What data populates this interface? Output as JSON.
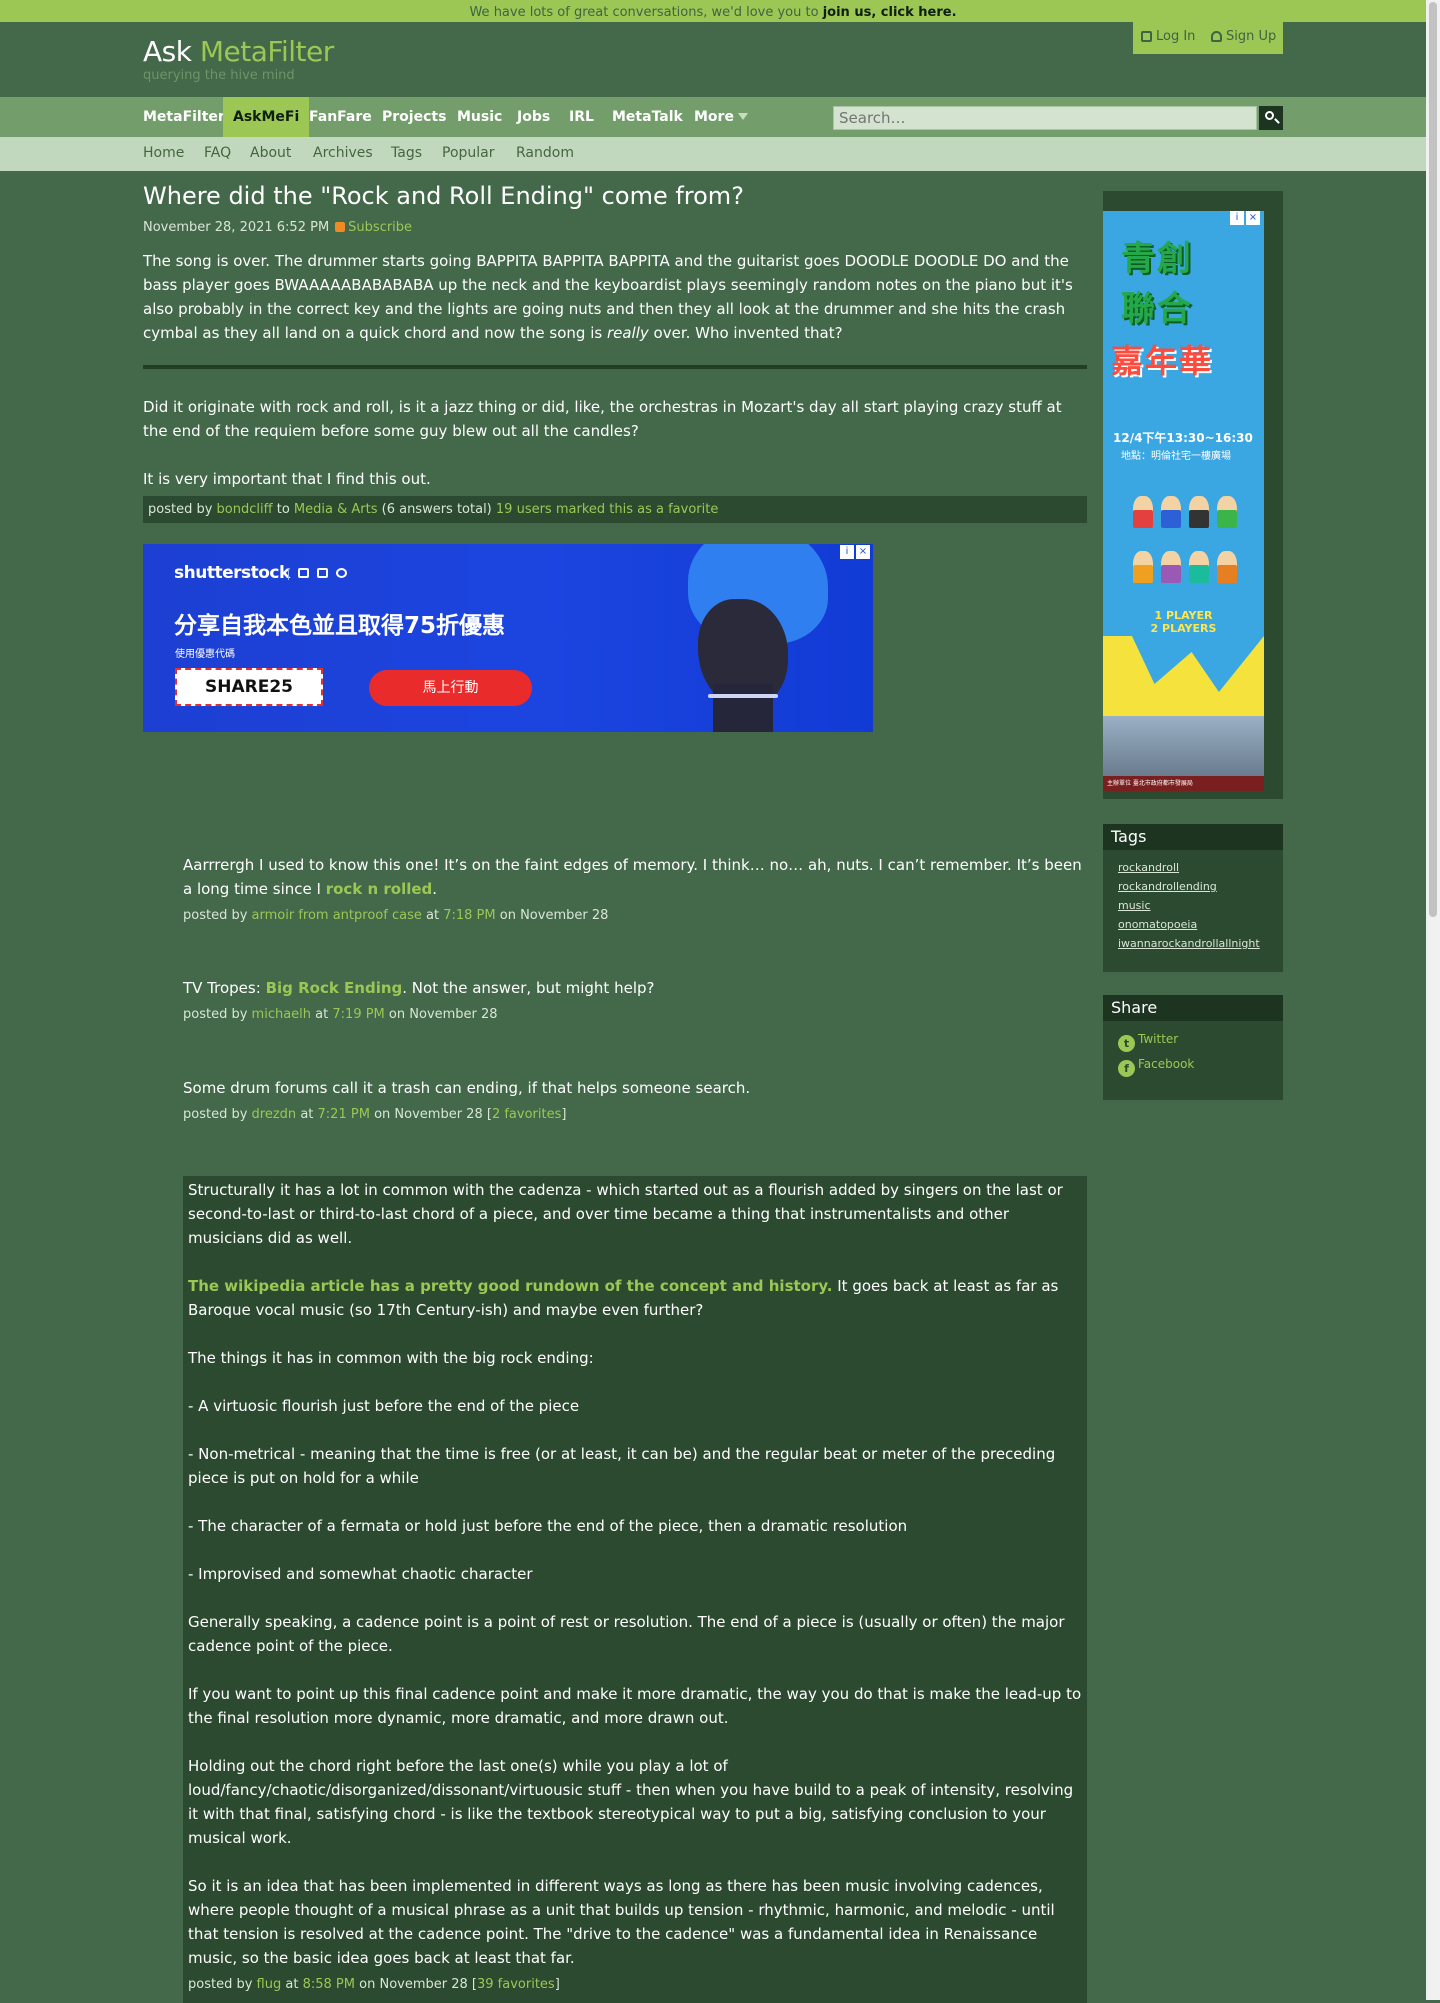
{
  "announcement": {
    "text": "We have lots of great conversations, we'd love you to ",
    "link": "join us, click here."
  },
  "header": {
    "brand_ask": "Ask",
    "brand_mefi": "MetaFilter",
    "tagline": "querying the hive mind",
    "login": "Log In",
    "signup": "Sign Up"
  },
  "nav": {
    "items": [
      "MetaFilter",
      "AskMeFi",
      "FanFare",
      "Projects",
      "Music",
      "Jobs",
      "IRL",
      "MetaTalk",
      "More"
    ],
    "active": "AskMeFi",
    "search_placeholder": "Search…"
  },
  "subnav": [
    "Home",
    "FAQ",
    "About",
    "Archives",
    "Tags",
    "Popular",
    "Random"
  ],
  "post": {
    "title": "Where did the \"Rock and Roll Ending\" come from?",
    "date": "November 28, 2021 6:52 PM",
    "subscribe": "Subscribe",
    "body_pre": "The song is over. The drummer starts going BAPPITA BAPPITA BAPPITA and the guitarist goes DOODLE DOODLE DO and the bass player goes BWAAAAABABABABA up the neck and the keyboardist plays seemingly random notes on the piano but it's also probably in the correct key and the lights are going nuts and then they all look at the drummer and she hits the crash cymbal as they all land on a quick chord and now the song is ",
    "body_em": "really",
    "body_post": " over. Who invented that?",
    "more_1": "Did it originate with rock and roll, is it a jazz thing or did, like, the orchestras in Mozart's day all start playing crazy stuff at the end of the requiem before some guy blew out all the candles?",
    "more_2": "It is very important that I find this out.",
    "posted_by": "posted by",
    "author": "bondcliff",
    "to": "to",
    "category": "Media & Arts",
    "answers": "(6 answers total)",
    "favorites": "19 users marked this as a favorite"
  },
  "banner_ad": {
    "brand": "shutterstock",
    "headline": "分享自我本色並且取得75折優惠",
    "sub": "使用優惠代碼",
    "code": "SHARE25",
    "cta": "馬上行動"
  },
  "comments": [
    {
      "pre": "Aarrrergh I used to know this one! It’s on the faint edges of memory. I think… no… ah, nuts. I can’t remember. It’s been a long time since I ",
      "link": "rock n rolled",
      "post": ".",
      "author": "armoir from antproof case",
      "time": "7:18 PM",
      "date": "November 28"
    },
    {
      "pre": "TV Tropes: ",
      "link": "Big Rock Ending",
      "post": ". Not the answer, but might help?",
      "author": "michaelh",
      "time": "7:19 PM",
      "date": "November 28"
    },
    {
      "text": "Some drum forums call it a trash can ending, if that helps someone search.",
      "author": "drezdn",
      "time": "7:21 PM",
      "date": "November 28",
      "favs": "2 favorites"
    },
    {
      "p1": "Structurally it has a lot in common with the cadenza - which started out as a flourish added by singers on the last or second-to-last or third-to-last chord of a piece, and over time became a thing that instrumentalists and other musicians did as well.",
      "p2_link": "The wikipedia article has a pretty good rundown of the concept and history.",
      "p2_rest": " It goes back at least as far as Baroque vocal music (so 17th Century-ish) and maybe even further?",
      "p3": "The things it has in common with the big rock ending:",
      "p4": "- A virtuosic flourish just before the end of the piece",
      "p5": "- Non-metrical - meaning that the time is free (or at least, it can be) and the regular beat or meter of the preceding piece is put on hold for a while",
      "p6": "- The character of a fermata or hold just before the end of the piece, then a dramatic resolution",
      "p7": "- Improvised and somewhat chaotic character",
      "p8": "Generally speaking, a cadence point is a point of rest or resolution. The end of a piece is (usually or often) the major cadence point of the piece.",
      "p9": "If you want to point up this final cadence point and make it more dramatic, the way you do that is make the lead-up to the final resolution more dynamic, more dramatic, and more drawn out.",
      "p10": "Holding out the chord right before the last one(s) while you play a lot of loud/fancy/chaotic/disorganized/dissonant/virtuousic stuff - then when you have build to a peak of intensity, resolving it with that final, satisfying chord - is like the textbook stereotypical way to put a big, satisfying conclusion to your musical work.",
      "p11": "So it is an idea that has been implemented in different ways as long as there has been music involving cadences, where people thought of a musical phrase as a unit that builds up tension - rhythmic, harmonic, and melodic - until that tension is resolved at the cadence point. The \"drive to the cadence\" was a fundamental idea in Renaissance music, so the basic idea goes back at least that far.",
      "author": "flug",
      "time": "8:58 PM",
      "date": "November 28",
      "favs": "39 favorites"
    }
  ],
  "meta_words": {
    "posted_by": "posted by",
    "at": "at",
    "on": "on"
  },
  "sidebar": {
    "ad": {
      "title1": "青創",
      "title2": "聯合",
      "title3": "嘉年華",
      "date": "12/4下午13:30~16:30",
      "location": "地點：明倫社宅一樓廣場",
      "players1": "1 PLAYER",
      "players2": "2 PLAYERS",
      "footer": "主辦單位  臺北市政府都市發展局"
    },
    "tags_title": "Tags",
    "tags": [
      "rockandroll",
      "rockandrollending",
      "music",
      "onomatopoeia",
      "iwannarockandrollallnight"
    ],
    "share_title": "Share",
    "share": [
      "Twitter",
      "Facebook"
    ]
  },
  "colors": {
    "background": "#43684a",
    "accent": "#9cc754",
    "dark_panel": "#2c4a30",
    "nav": "#739e6b",
    "subnav": "#c2d8be"
  },
  "icons": [
    "login-icon",
    "user-icon",
    "search-icon",
    "rss-icon",
    "twitter-icon",
    "facebook-icon",
    "adchoices-icon",
    "close-icon"
  ]
}
